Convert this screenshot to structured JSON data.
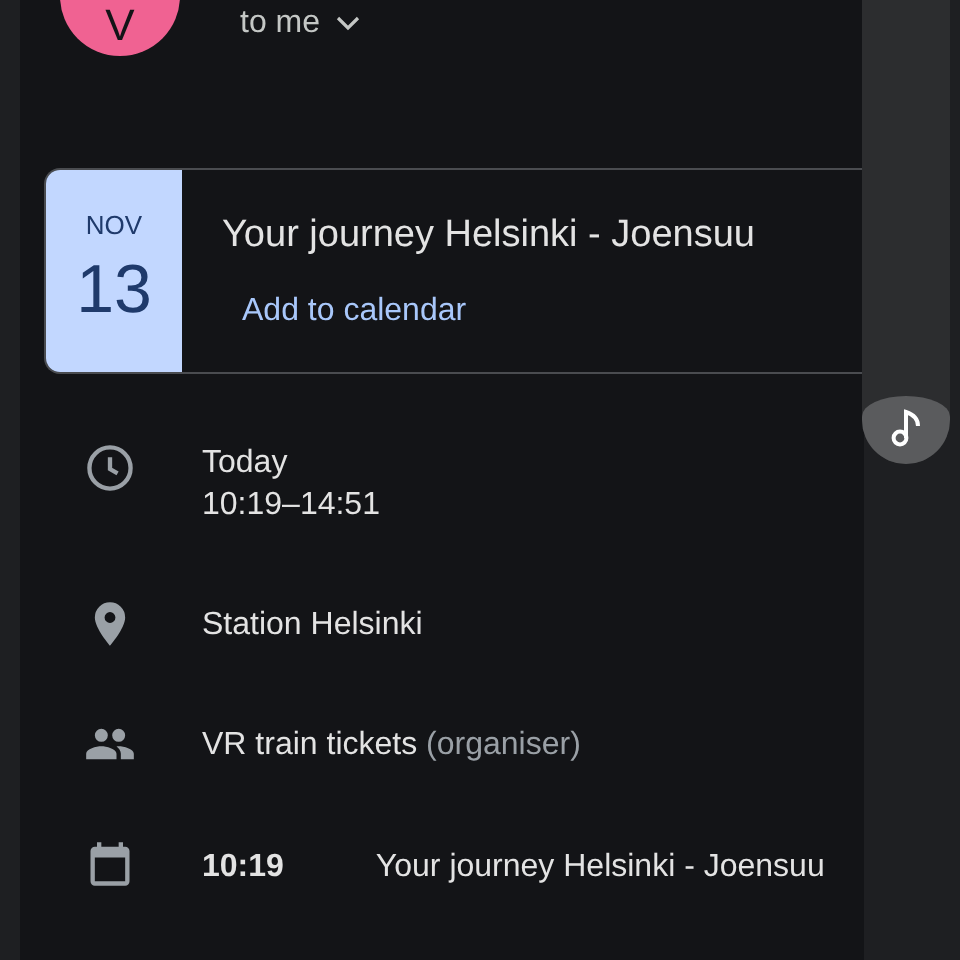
{
  "sender": {
    "avatar_letter": "V",
    "recipient": "to me"
  },
  "event_card": {
    "month": "NOV",
    "day": "13",
    "title": "Your journey Helsinki - Joensuu",
    "action": "Add to calendar"
  },
  "details": [
    {
      "kind": "time",
      "lines": [
        "Today",
        "10:19–14:51"
      ]
    },
    {
      "kind": "place",
      "lines": [
        "Station Helsinki"
      ]
    },
    {
      "kind": "people",
      "lines": [
        "VR train tickets"
      ],
      "note": "(organiser)"
    },
    {
      "kind": "calendar",
      "time": "10:19",
      "lines": [
        "Your journey Helsinki - Joensuu"
      ]
    }
  ]
}
